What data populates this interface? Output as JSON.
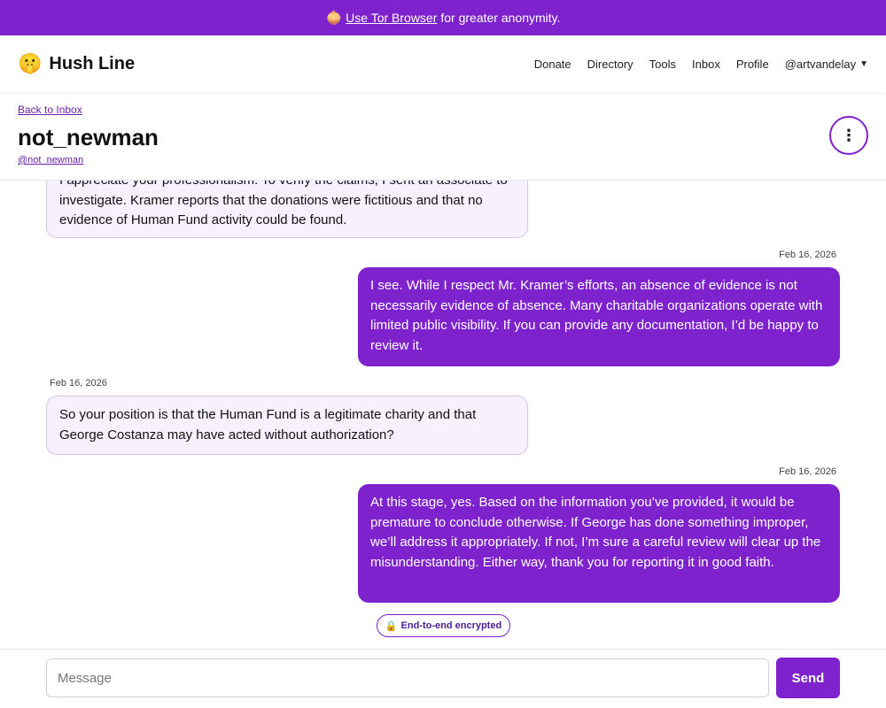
{
  "banner": {
    "icon": "onion-icon",
    "link_text": "Use Tor Browser",
    "suffix": "for greater anonymity."
  },
  "nav": {
    "brand_icon": "shushing-face-icon",
    "brand": "Hush Line",
    "links": [
      "Donate",
      "Directory",
      "Tools",
      "Inbox",
      "Profile"
    ],
    "user": "@artvandelay"
  },
  "thread": {
    "back_label": "Back to Inbox",
    "title": "not_newman",
    "handle": "@not_newman",
    "more_icon": "vertical-ellipsis-icon"
  },
  "messages": [
    {
      "direction": "in",
      "date": "",
      "text": "I appreciate your professionalism. To verify the claims, I sent an associate to investigate. Kramer reports that the donations were fictitious and that no evidence of Human Fund activity could be found."
    },
    {
      "direction": "out",
      "date": "Feb 16, 2026",
      "text": "I see. While I respect Mr. Kramer’s efforts, an absence of evidence is not necessarily evidence of absence. Many charitable organizations operate with limited public visibility. If you can provide any documentation, I’d be happy to review it."
    },
    {
      "direction": "in",
      "date": "Feb 16, 2026",
      "text": "So your position is that the Human Fund is a legitimate charity and that George Costanza may have acted without authorization?"
    },
    {
      "direction": "out",
      "date": "Feb 16, 2026",
      "text": "At this stage, yes. Based on the information you’ve provided, it would be premature to conclude otherwise. If George has done something improper, we’ll address it appropriately. If not, I’m sure a careful review will clear up the misunderstanding. Either way, thank you for reporting it in good faith."
    }
  ],
  "encryption_badge": {
    "icon": "lock-icon",
    "label": "End-to-end encrypted"
  },
  "composer": {
    "placeholder": "Message",
    "value": "",
    "send_label": "Send"
  },
  "colors": {
    "accent": "#7e22ce",
    "incoming_bubble": "#f7f0fe",
    "incoming_border": "#d8c6ee"
  }
}
